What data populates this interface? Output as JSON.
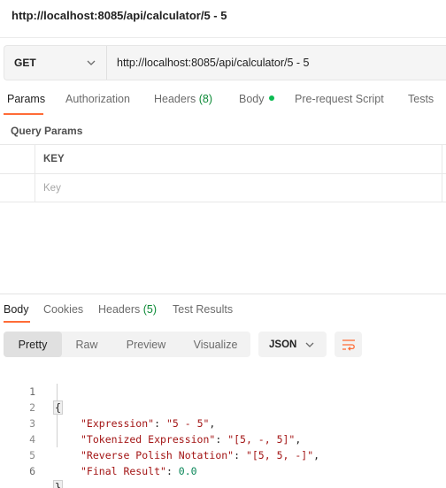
{
  "request": {
    "title": "http://localhost:8085/api/calculator/5 - 5",
    "method": "GET",
    "url": "http://localhost:8085/api/calculator/5 - 5"
  },
  "request_tabs": [
    {
      "label": "Params",
      "active": true
    },
    {
      "label": "Authorization"
    },
    {
      "label": "Headers",
      "count": "(8)"
    },
    {
      "label": "Body",
      "indicator": "green-dot"
    },
    {
      "label": "Pre-request Script"
    },
    {
      "label": "Tests"
    }
  ],
  "query_params": {
    "title": "Query Params",
    "header_key": "KEY",
    "placeholder_key": "Key"
  },
  "response_tabs": [
    {
      "label": "Body",
      "active": true
    },
    {
      "label": "Cookies"
    },
    {
      "label": "Headers",
      "count": "(5)"
    },
    {
      "label": "Test Results"
    }
  ],
  "view_options": [
    {
      "label": "Pretty",
      "active": true
    },
    {
      "label": "Raw"
    },
    {
      "label": "Preview"
    },
    {
      "label": "Visualize"
    }
  ],
  "format": {
    "selected": "JSON"
  },
  "icons": {
    "method_dropdown": "chevron-down-icon",
    "format_dropdown": "chevron-down-icon",
    "wrap": "wrap-lines-icon"
  },
  "colors": {
    "accent": "#ff6c37",
    "count_green": "#0c8a36",
    "body_dot": "#0cbb52",
    "json_key": "#a31515",
    "json_number": "#098658"
  },
  "response_body": {
    "line_numbers": [
      "1",
      "2",
      "3",
      "4",
      "5",
      "6"
    ],
    "open_brace": "{",
    "close_brace": "}",
    "entries": [
      {
        "key": "\"Expression\"",
        "value": "\"5 - 5\"",
        "type": "string",
        "trail": ","
      },
      {
        "key": "\"Tokenized Expression\"",
        "value": "\"[5, -, 5]\"",
        "type": "string",
        "trail": ","
      },
      {
        "key": "\"Reverse Polish Notation\"",
        "value": "\"[5, 5, -]\"",
        "type": "string",
        "trail": ","
      },
      {
        "key": "\"Final Result\"",
        "value": "0.0",
        "type": "number",
        "trail": ""
      }
    ]
  }
}
